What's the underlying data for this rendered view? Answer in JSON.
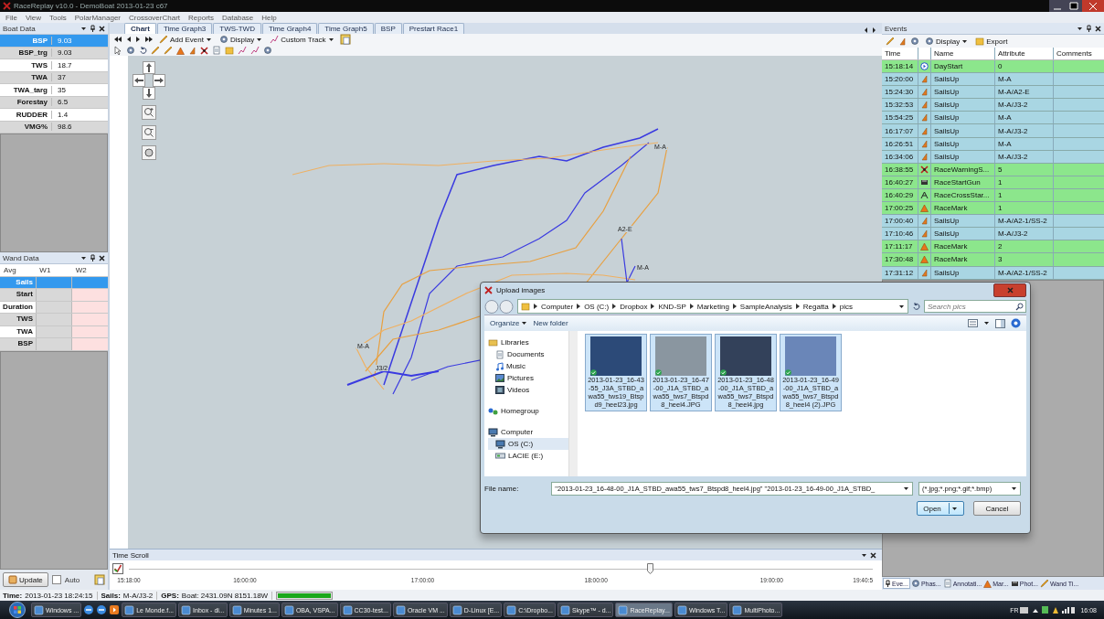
{
  "window": {
    "title": "RaceReplay v10.0 - DemoBoat 2013-01-23 c67"
  },
  "menu": [
    "File",
    "View",
    "Tools",
    "PolarManager",
    "CrossoverChart",
    "Reports",
    "Database",
    "Help"
  ],
  "boat_data": {
    "title": "Boat Data",
    "rows": [
      {
        "label": "BSP",
        "value": "9.03",
        "selected": true
      },
      {
        "label": "BSP_trg",
        "value": "9.03",
        "selected": false
      },
      {
        "label": "TWS",
        "value": "18.7",
        "selected": false
      },
      {
        "label": "TWA",
        "value": "37",
        "selected": false
      },
      {
        "label": "TWA_targ",
        "value": "35",
        "selected": false
      },
      {
        "label": "Forestay",
        "value": "6.5",
        "selected": false
      },
      {
        "label": "RUDDER",
        "value": "1.4",
        "selected": false
      },
      {
        "label": "VMG%",
        "value": "98.6",
        "selected": false
      }
    ]
  },
  "wand_data": {
    "title": "Wand Data",
    "columns": [
      "Avg",
      "W1",
      "W2"
    ],
    "rows": [
      {
        "label": "Sails",
        "selected": true
      },
      {
        "label": "Start",
        "selected": false
      },
      {
        "label": "Duration",
        "selected": false
      },
      {
        "label": "TWS",
        "selected": false
      },
      {
        "label": "TWA",
        "selected": false
      },
      {
        "label": "BSP",
        "selected": false
      }
    ]
  },
  "left_footer": {
    "update": "Update",
    "auto": {
      "label": "Auto",
      "checked": false
    }
  },
  "tabs": [
    {
      "label": "Chart",
      "selected": true
    },
    {
      "label": "Time Graph3",
      "selected": false
    },
    {
      "label": "TWS-TWD",
      "selected": false
    },
    {
      "label": "Time Graph4",
      "selected": false
    },
    {
      "label": "Time Graph5",
      "selected": false
    },
    {
      "label": "BSP",
      "selected": false
    },
    {
      "label": "Prestart Race1",
      "selected": false
    }
  ],
  "chart_toolbar": [
    "Add Event",
    "Display",
    "Custom Track"
  ],
  "map_labels": [
    "M-A",
    "A2-E",
    "M-A",
    "M-A",
    "J3/2"
  ],
  "time_scroll": {
    "title": "Time Scroll",
    "level": 0.7,
    "ticks": [
      "15:18:00",
      "16:00:00",
      "17:00:00",
      "18:00:00",
      "19:00:00",
      "19:40:5"
    ]
  },
  "events": {
    "title": "Events",
    "toolbar": [
      "Display",
      "Export"
    ],
    "columns": [
      "Time",
      "Name",
      "Attribute",
      "Comments"
    ],
    "rows": [
      {
        "time": "15:18:14",
        "kind": "start",
        "name": "DayStart",
        "attribute": "0",
        "color": "#8ce68c"
      },
      {
        "time": "15:20:00",
        "kind": "sails",
        "name": "SailsUp",
        "attribute": "M-A",
        "color": "#a9d6e3"
      },
      {
        "time": "15:24:30",
        "kind": "sails",
        "name": "SailsUp",
        "attribute": "M-A/A2-E",
        "color": "#a9d6e3"
      },
      {
        "time": "15:32:53",
        "kind": "sails",
        "name": "SailsUp",
        "attribute": "M-A/J3-2",
        "color": "#a9d6e3"
      },
      {
        "time": "15:54:25",
        "kind": "sails",
        "name": "SailsUp",
        "attribute": "M-A",
        "color": "#a9d6e3"
      },
      {
        "time": "16:17:07",
        "kind": "sails",
        "name": "SailsUp",
        "attribute": "M-A/J3-2",
        "color": "#a9d6e3"
      },
      {
        "time": "16:26:51",
        "kind": "sails",
        "name": "SailsUp",
        "attribute": "M-A",
        "color": "#a9d6e3"
      },
      {
        "time": "16:34:06",
        "kind": "sails",
        "name": "SailsUp",
        "attribute": "M-A/J3-2",
        "color": "#a9d6e3"
      },
      {
        "time": "16:38:55",
        "kind": "warning",
        "name": "RaceWarningS...",
        "attribute": "5",
        "color": "#8ce68c"
      },
      {
        "time": "16:40:27",
        "kind": "gun",
        "name": "RaceStartGun",
        "attribute": "1",
        "color": "#8ce68c"
      },
      {
        "time": "16:40:29",
        "kind": "cross",
        "name": "RaceCrossStar...",
        "attribute": "1",
        "color": "#8ce68c"
      },
      {
        "time": "17:00:25",
        "kind": "mark",
        "name": "RaceMark",
        "attribute": "1",
        "color": "#8ce68c"
      },
      {
        "time": "17:00:40",
        "kind": "sails",
        "name": "SailsUp",
        "attribute": "M-A/A2-1/SS-2",
        "color": "#a9d6e3"
      },
      {
        "time": "17:10:46",
        "kind": "sails",
        "name": "SailsUp",
        "attribute": "M-A/J3-2",
        "color": "#a9d6e3"
      },
      {
        "time": "17:11:17",
        "kind": "mark",
        "name": "RaceMark",
        "attribute": "2",
        "color": "#8ce68c"
      },
      {
        "time": "17:30:48",
        "kind": "mark",
        "name": "RaceMark",
        "attribute": "3",
        "color": "#8ce68c"
      },
      {
        "time": "17:31:12",
        "kind": "sails",
        "name": "SailsUp",
        "attribute": "M-A/A2-1/SS-2",
        "color": "#a9d6e3"
      }
    ]
  },
  "bottom_tabs": [
    {
      "label": "Eve...",
      "selected": true
    },
    {
      "label": "Phas...",
      "selected": false
    },
    {
      "label": "Annotati...",
      "selected": false
    },
    {
      "label": "Mar...",
      "selected": false
    },
    {
      "label": "Phot...",
      "selected": false
    },
    {
      "label": "Wand Ti...",
      "selected": false
    }
  ],
  "dialog": {
    "title": "Upload images",
    "path": [
      "Computer",
      "OS (C:)",
      "Dropbox",
      "KND-SP",
      "Marketing",
      "SampleAnalysis",
      "Regatta",
      "pics"
    ],
    "search": {
      "placeholder": "Search pics"
    },
    "toolbar": [
      "Organize",
      "New folder"
    ],
    "nav": [
      {
        "label": "Libraries",
        "selected": false,
        "children": [
          {
            "label": "Documents",
            "selected": false
          },
          {
            "label": "Music",
            "selected": false
          },
          {
            "label": "Pictures",
            "selected": false
          },
          {
            "label": "Videos",
            "selected": false
          }
        ]
      },
      {
        "label": "Homegroup",
        "selected": false
      },
      {
        "label": "Computer",
        "selected": false,
        "children": [
          {
            "label": "OS (C:)",
            "selected": true
          },
          {
            "label": "LACIE (E:)",
            "selected": false
          }
        ]
      }
    ],
    "files": [
      {
        "name": "2013-01-23_16-43-55_J3A_STBD_awa55_tws19_Btspd9_heel23.jpg",
        "selected": true
      },
      {
        "name": "2013-01-23_16-47-00_J1A_STBD_awa55_tws7_Btspd8_heel4.JPG",
        "selected": true
      },
      {
        "name": "2013-01-23_16-48-00_J1A_STBD_awa55_tws7_Btspd8_heel4.jpg",
        "selected": true
      },
      {
        "name": "2013-01-23_16-49-00_J1A_STBD_awa55_tws7_Btspd8_heel4 (2).JPG",
        "selected": true
      }
    ],
    "file_name_label": "File name:",
    "file_name": "\"2013-01-23_16-48-00_J1A_STBD_awa55_tws7_Btspd8_heel4.jpg\" \"2013-01-23_16-49-00_J1A_STBD_",
    "filter": "(*.jpg;*.png;*.gif;*.bmp)",
    "buttons": [
      "Open",
      "Cancel"
    ]
  },
  "status_bar": [
    {
      "label": "Time:",
      "value": "2013-01-23 18:24:15"
    },
    {
      "label": "Sails:",
      "value": "M-A/J3-2"
    },
    {
      "label": "GPS:",
      "value": "Boat: 2431.09N 8151.18W"
    }
  ],
  "gps_signal": {
    "level": 1
  },
  "taskbar": {
    "items": [
      {
        "label": "Windows ...",
        "selected": false
      },
      {
        "label": "Le Monde.f...",
        "selected": false
      },
      {
        "label": "Inbox - di...",
        "selected": false
      },
      {
        "label": "Minutes 1...",
        "selected": false
      },
      {
        "label": "OBA, VSPA...",
        "selected": false
      },
      {
        "label": "CC30-test...",
        "selected": false
      },
      {
        "label": "Oracle VM ...",
        "selected": false
      },
      {
        "label": "D-Linux [E...",
        "selected": false
      },
      {
        "label": "C:\\Dropbo...",
        "selected": false
      },
      {
        "label": "Skype™ - d...",
        "selected": false
      },
      {
        "label": "RaceReplay...",
        "selected": true
      },
      {
        "label": "Windows T...",
        "selected": false
      },
      {
        "label": "MultiPhoto...",
        "selected": false
      }
    ],
    "language": "FR",
    "clock": "16:08"
  }
}
